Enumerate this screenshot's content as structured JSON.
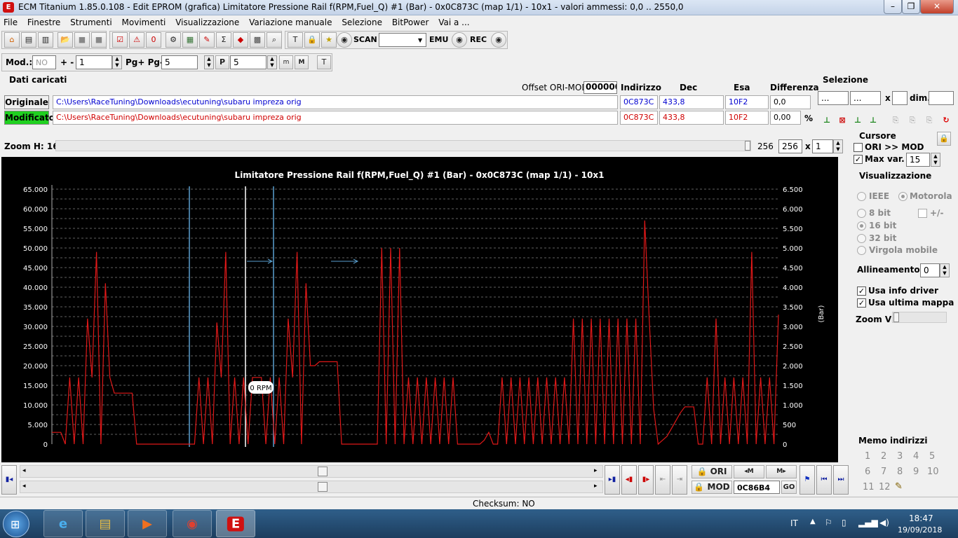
{
  "window": {
    "title": "ECM Titanium 1.85.0.108 - Edit EPROM (grafica) Limitatore Pressione Rail f(RPM,Fuel_Q) #1 (Bar) - 0x0C873C (map 1/1) - 10x1 - valori ammessi: 0,0 .. 2550,0",
    "app_icon": "ecm-titanium-icon"
  },
  "menu": [
    "File",
    "Finestre",
    "Strumenti",
    "Movimenti",
    "Visualizzazione",
    "Variazione manuale",
    "Selezione",
    "BitPower",
    "Vai a ..."
  ],
  "toolbar": {
    "scan_label": "SCAN",
    "scan_select": "",
    "emu_label": "EMU",
    "rec_label": "REC"
  },
  "toolbar2": {
    "mod_label": "Mod.:",
    "mod_value": "NO",
    "plusminus_label": "+ -",
    "plusminus_value": "1",
    "pg_label": "Pg+ Pg-",
    "pg_value": "5",
    "p_value": "5"
  },
  "dati": {
    "title": "Dati caricati",
    "offset_label": "Offset ORI-MOD",
    "offset_value": "000000",
    "col_indirizzo": "Indirizzo",
    "col_dec": "Dec",
    "col_esa": "Esa",
    "col_differenza": "Differenza",
    "originale": {
      "label": "Originale",
      "path": "C:\\Users\\RaceTuning\\Downloads\\ecutuning\\subaru impreza orig",
      "indirizzo": "0C873C",
      "dec": "433,8",
      "esa": "10F2",
      "differenza": "0,0"
    },
    "modificato": {
      "label": "Modificato",
      "path": "C:\\Users\\RaceTuning\\Downloads\\ecutuning\\subaru impreza orig",
      "indirizzo": "0C873C",
      "dec": "433,8",
      "esa": "10F2",
      "differenza": "0,00",
      "percent": "%"
    }
  },
  "selezione": {
    "title": "Selezione",
    "from": "...",
    "to": "...",
    "x_label": "x",
    "x_value": "",
    "dim_label": "dim.",
    "dim_value": ""
  },
  "zoom": {
    "label": "Zoom H: 16",
    "value_a": "256",
    "value_b": "256",
    "x_label": "x",
    "multiplier": "1"
  },
  "cursore": {
    "title": "Cursore",
    "ori_mod_label": "ORI >> MOD",
    "ori_mod_checked": false,
    "max_var_label": "Max var.",
    "max_var_checked": true,
    "max_var_value": "15"
  },
  "visualizzazione": {
    "title": "Visualizzazione",
    "ieee": "IEEE",
    "motorola": "Motorola",
    "bit8": "8 bit",
    "plusminus": "+/-",
    "bit16": "16 bit",
    "bit32": "32 bit",
    "virgola": "Virgola mobile",
    "allineamento_label": "Allineamento:",
    "allineamento_value": "0",
    "usa_info_driver": "Usa info driver",
    "usa_ultima_mappa": "Usa ultima mappa",
    "zoom_v_label": "Zoom V:"
  },
  "memo": {
    "title": "Memo indirizzi",
    "numbers": [
      "1",
      "2",
      "3",
      "4",
      "5",
      "6",
      "7",
      "8",
      "9",
      "10",
      "11",
      "12"
    ]
  },
  "bottom": {
    "ori_label": "ORI",
    "mod_label": "MOD",
    "address": "0C86B4",
    "go_label": "GO",
    "checksum": "Checksum: NO"
  },
  "taskbar": {
    "lang": "IT",
    "time": "18:47",
    "date": "19/09/2018"
  },
  "colors": {
    "chart_bg": "#000000",
    "chart_line": "#e01818",
    "grid": "#bdbdbd",
    "markers": "#5aa0d0",
    "modificato_bg": "#20d020"
  },
  "chart_data": {
    "type": "line",
    "title": "Limitatore Pressione Rail f(RPM,Fuel_Q) #1 (Bar) - 0x0C873C (map 1/1) - 10x1",
    "ylabel_right": "(Bar)",
    "left_ticks": [
      "65.000",
      "60.000",
      "55.000",
      "50.000",
      "45.000",
      "40.000",
      "35.000",
      "30.000",
      "25.000",
      "20.000",
      "15.000",
      "10.000",
      "5.000",
      "0"
    ],
    "right_ticks": [
      "6.500",
      "6.000",
      "5.500",
      "5.000",
      "4.500",
      "4.000",
      "3.500",
      "3.000",
      "2.500",
      "2.000",
      "1.500",
      "1.000",
      "500",
      "0"
    ],
    "ylim": [
      0,
      65000
    ],
    "cursor_label": "0 RPM",
    "grid": true,
    "series": [
      {
        "values": [
          3000,
          3000,
          3000,
          0,
          17000,
          0,
          17000,
          0,
          32000,
          17000,
          49000,
          0,
          41000,
          17000,
          13000,
          13000,
          13000,
          13000,
          13000,
          0,
          0,
          0,
          0,
          0,
          0,
          0,
          0,
          0,
          0,
          0,
          0,
          0,
          0,
          17000,
          0,
          17000,
          0,
          31000,
          17000,
          49000,
          0,
          17000,
          0,
          17000,
          0,
          17000,
          17000,
          17000,
          0,
          17000,
          0,
          17000,
          0,
          32000,
          17000,
          49000,
          0,
          41000,
          20000,
          20000,
          21000,
          21000,
          21000,
          21000,
          21000,
          0,
          0,
          0,
          0,
          0,
          0,
          0,
          0,
          0,
          50000,
          0,
          50000,
          0,
          50000,
          0,
          17000,
          0,
          17000,
          0,
          17000,
          0,
          17000,
          0,
          17000,
          0,
          17000,
          0,
          0,
          0,
          0,
          0,
          0,
          1000,
          3000,
          0,
          0,
          17000,
          0,
          17000,
          0,
          17000,
          0,
          17000,
          0,
          17000,
          0,
          17000,
          0,
          17000,
          0,
          17000,
          0,
          32000,
          0,
          32000,
          0,
          32000,
          0,
          32000,
          0,
          32000,
          0,
          32000,
          0,
          32000,
          0,
          32000,
          0,
          57000,
          32000,
          9000,
          0,
          1000,
          2000,
          4000,
          6000,
          8000,
          9500,
          9500,
          9500,
          0,
          0,
          17000,
          0,
          32000,
          0,
          17000,
          0,
          17000,
          0,
          17000,
          0,
          49000,
          0,
          17000,
          0,
          17000,
          0,
          33000
        ]
      }
    ]
  }
}
